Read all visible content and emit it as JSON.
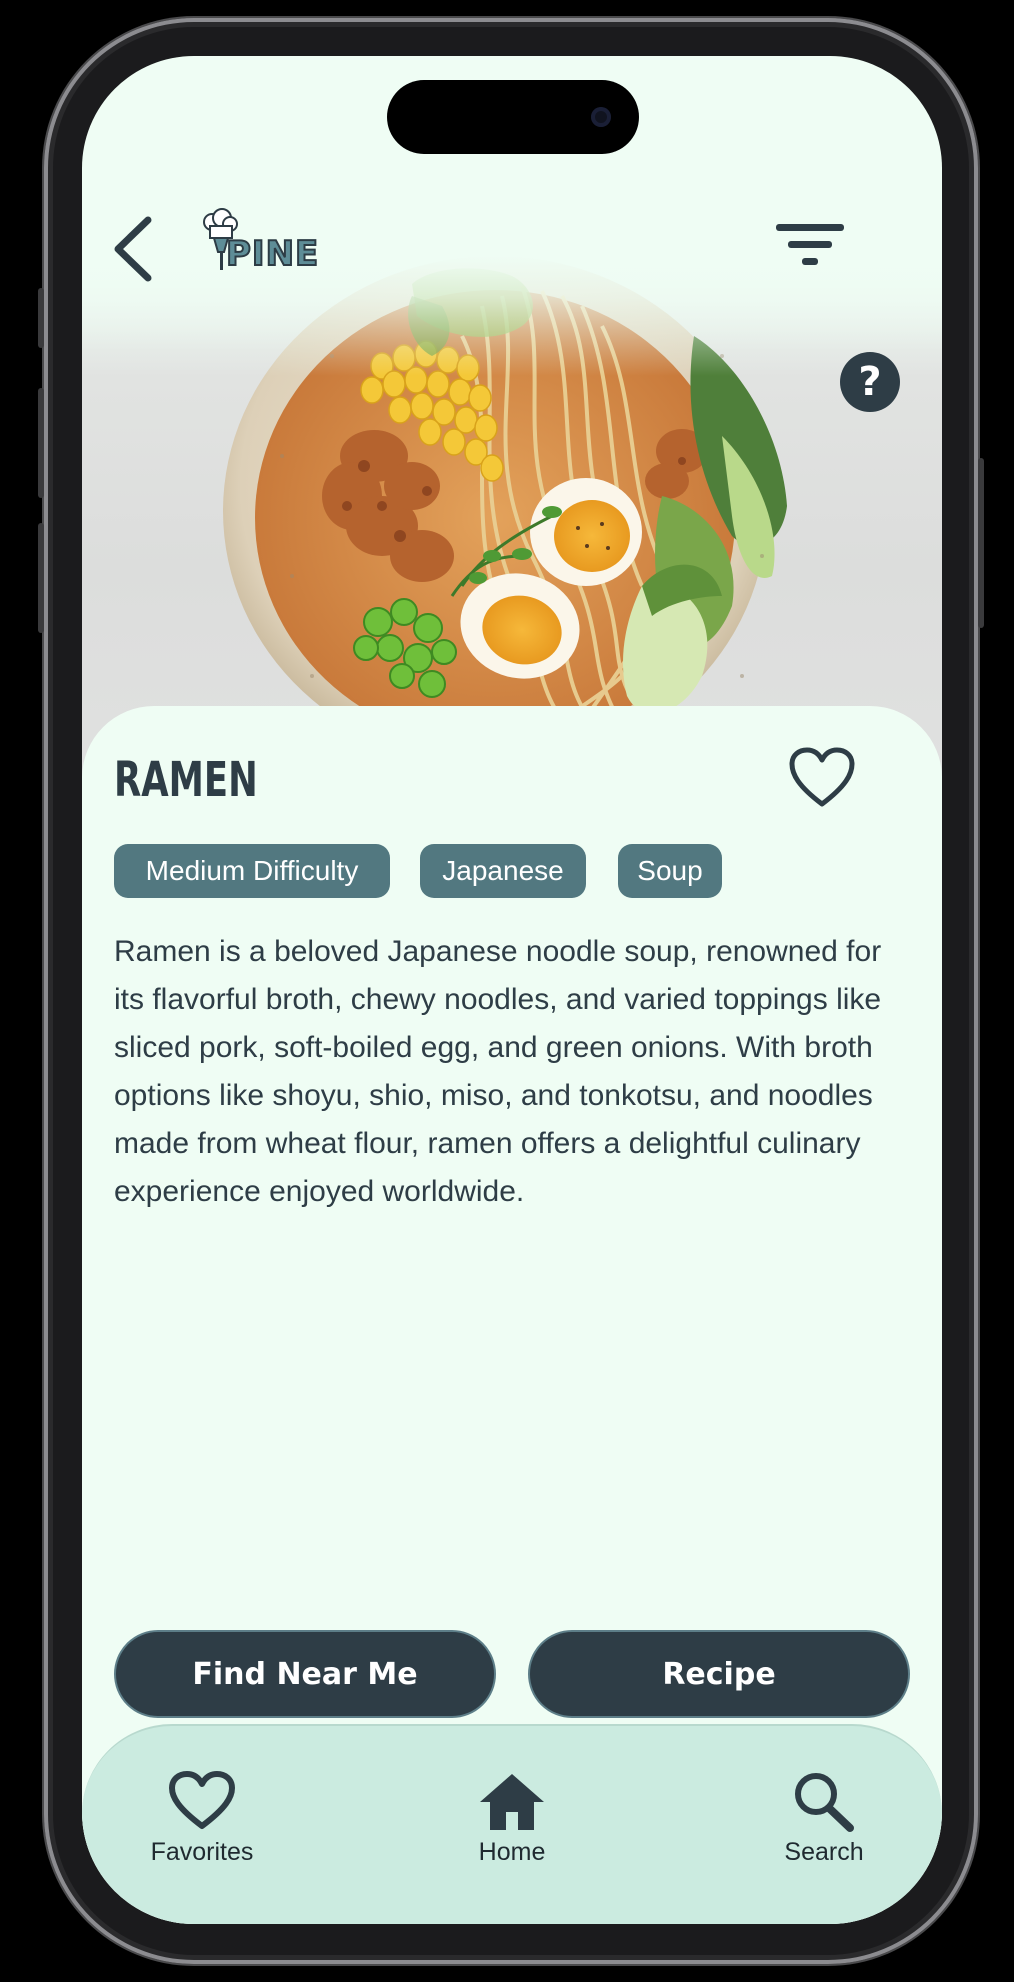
{
  "header": {
    "logo_text": "PINE",
    "back_icon": "chevron-left-icon",
    "filter_icon": "filter-icon"
  },
  "hero": {
    "help_label": "?"
  },
  "dish": {
    "title": "RAMEN",
    "tags": [
      "Medium Difficulty",
      "Japanese",
      "Soup"
    ],
    "description": "Ramen is a beloved Japanese noodle soup, renowned for its flavorful broth, chewy noodles, and varied toppings like sliced pork, soft-boiled egg, and green onions. With broth options like shoyu, shio, miso, and tonkotsu, and noodles made from wheat flour, ramen offers a delightful culinary experience enjoyed worldwide."
  },
  "actions": {
    "find_near_me": "Find Near Me",
    "recipe": "Recipe"
  },
  "bottom_nav": {
    "items": [
      {
        "label": "Favorites",
        "icon": "heart-icon"
      },
      {
        "label": "Home",
        "icon": "home-icon"
      },
      {
        "label": "Search",
        "icon": "search-icon"
      }
    ]
  },
  "colors": {
    "background": "#effdf4",
    "primary_dark": "#2e3d46",
    "tag_bg": "#527880",
    "nav_bg": "#cbebe0"
  }
}
